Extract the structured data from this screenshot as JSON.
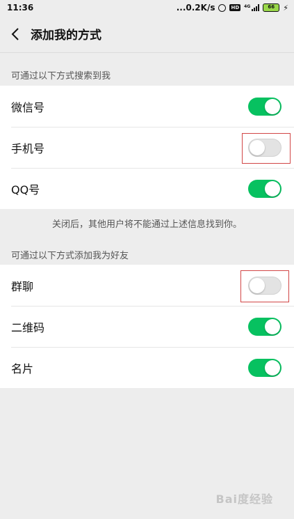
{
  "status_bar": {
    "time": "11:36",
    "network_speed": "...0.2K/s",
    "hd_badge": "HD",
    "signal_label": "4G",
    "battery": "66"
  },
  "nav": {
    "title": "添加我的方式"
  },
  "search_section": {
    "header": "可通过以下方式搜索到我",
    "items": [
      {
        "label": "微信号",
        "enabled": true
      },
      {
        "label": "手机号",
        "enabled": false
      },
      {
        "label": "QQ号",
        "enabled": true
      }
    ],
    "hint": "关闭后，其他用户将不能通过上述信息找到你。"
  },
  "add_section": {
    "header": "可通过以下方式添加我为好友",
    "items": [
      {
        "label": "群聊",
        "enabled": false
      },
      {
        "label": "二维码",
        "enabled": true
      },
      {
        "label": "名片",
        "enabled": true
      }
    ]
  },
  "colors": {
    "toggle_on": "#07c160",
    "toggle_off": "#e3e3e3",
    "highlight": "#d14545"
  },
  "watermark": "Bai度经验"
}
